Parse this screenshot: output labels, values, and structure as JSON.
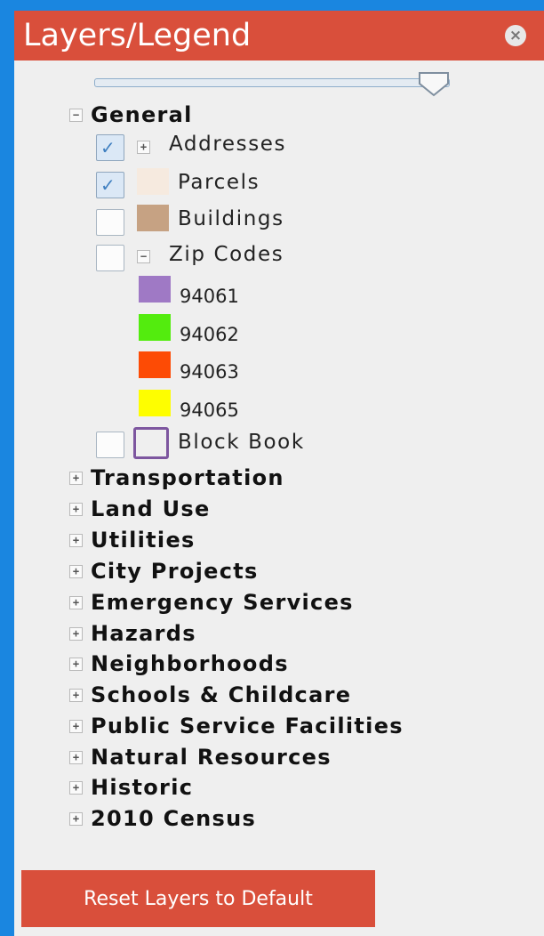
{
  "panel": {
    "title": "Layers/Legend",
    "close_icon": "close-icon",
    "opacity_slider": {
      "level": 0.95
    }
  },
  "general": {
    "label": "General",
    "expanded": true,
    "layers": [
      {
        "label": "Addresses",
        "checked": true,
        "icon": "plus-expand-icon"
      },
      {
        "label": "Parcels",
        "checked": true,
        "swatch": "#f6eadf"
      },
      {
        "label": "Buildings",
        "checked": false,
        "swatch": "#c6a283"
      },
      {
        "label": "Zip Codes",
        "checked": false,
        "icon": "minus-collapse-icon",
        "zips": [
          {
            "label": "94061",
            "color": "#9f79c5"
          },
          {
            "label": "94062",
            "color": "#53ec0e"
          },
          {
            "label": "94063",
            "color": "#fd4b05"
          },
          {
            "label": "94065",
            "color": "#fefe00"
          }
        ]
      },
      {
        "label": "Block Book",
        "checked": false,
        "outline": "#7d569f"
      }
    ]
  },
  "groups": [
    {
      "label": "Transportation"
    },
    {
      "label": "Land Use"
    },
    {
      "label": "Utilities"
    },
    {
      "label": "City Projects"
    },
    {
      "label": "Emergency Services"
    },
    {
      "label": "Hazards"
    },
    {
      "label": "Neighborhoods"
    },
    {
      "label": "Schools & Childcare"
    },
    {
      "label": "Public Service Facilities"
    },
    {
      "label": "Natural Resources"
    },
    {
      "label": "Historic"
    },
    {
      "label": "2010 Census"
    }
  ],
  "reset_label": "Reset Layers to Default",
  "colors": {
    "accent": "#d94f3b",
    "background": "#1a86e0",
    "panel": "#efefef"
  }
}
